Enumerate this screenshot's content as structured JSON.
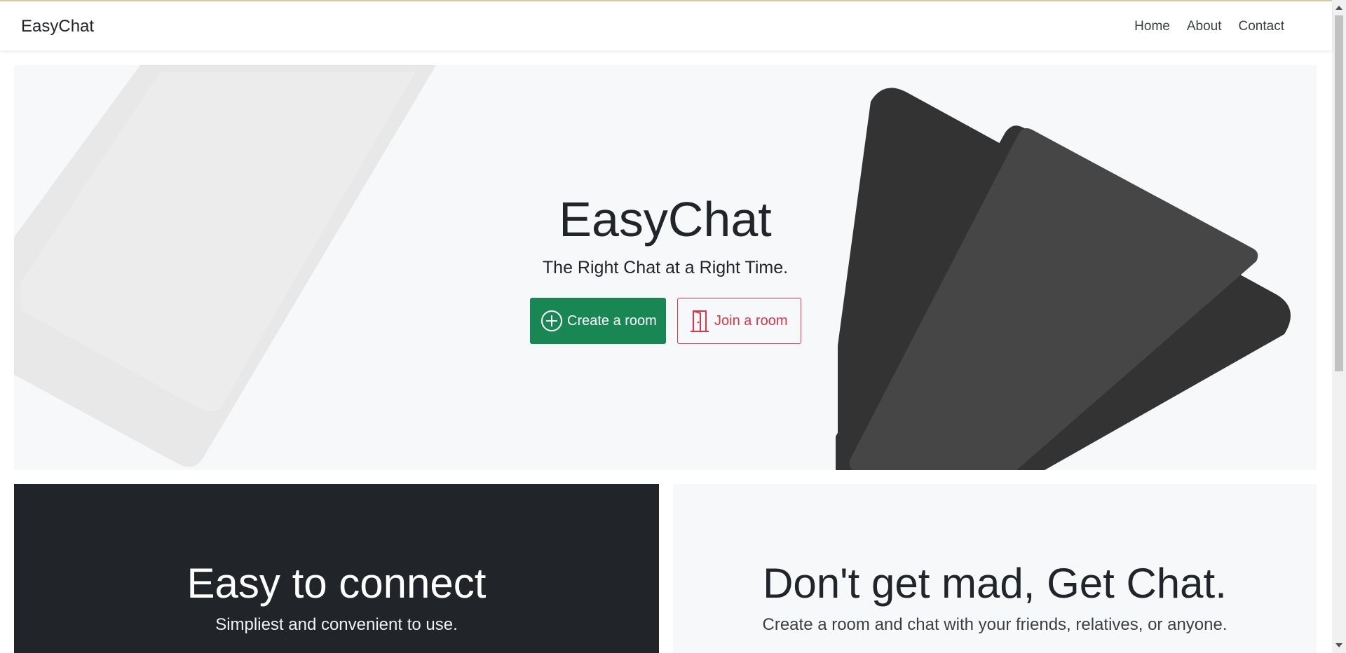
{
  "navbar": {
    "brand": "EasyChat",
    "links": [
      {
        "label": "Home"
      },
      {
        "label": "About"
      },
      {
        "label": "Contact"
      }
    ]
  },
  "hero": {
    "title": "EasyChat",
    "subtitle": "The Right Chat at a Right Time.",
    "create_button": {
      "label": "Create a room",
      "icon": "plus-circle-icon",
      "color": "#198754"
    },
    "join_button": {
      "label": "Join a room",
      "icon": "door-icon",
      "color": "#dc3545"
    }
  },
  "features": [
    {
      "title": "Easy to connect",
      "text": "Simpliest and convenient to use.",
      "theme": "dark"
    },
    {
      "title": "Don't get mad, Get Chat.",
      "text": "Create a room and chat with your friends, relatives, or anyone.",
      "theme": "light"
    }
  ],
  "colors": {
    "success": "#198754",
    "danger": "#dc3545",
    "dark": "#212529",
    "light": "#f7f8fa"
  }
}
